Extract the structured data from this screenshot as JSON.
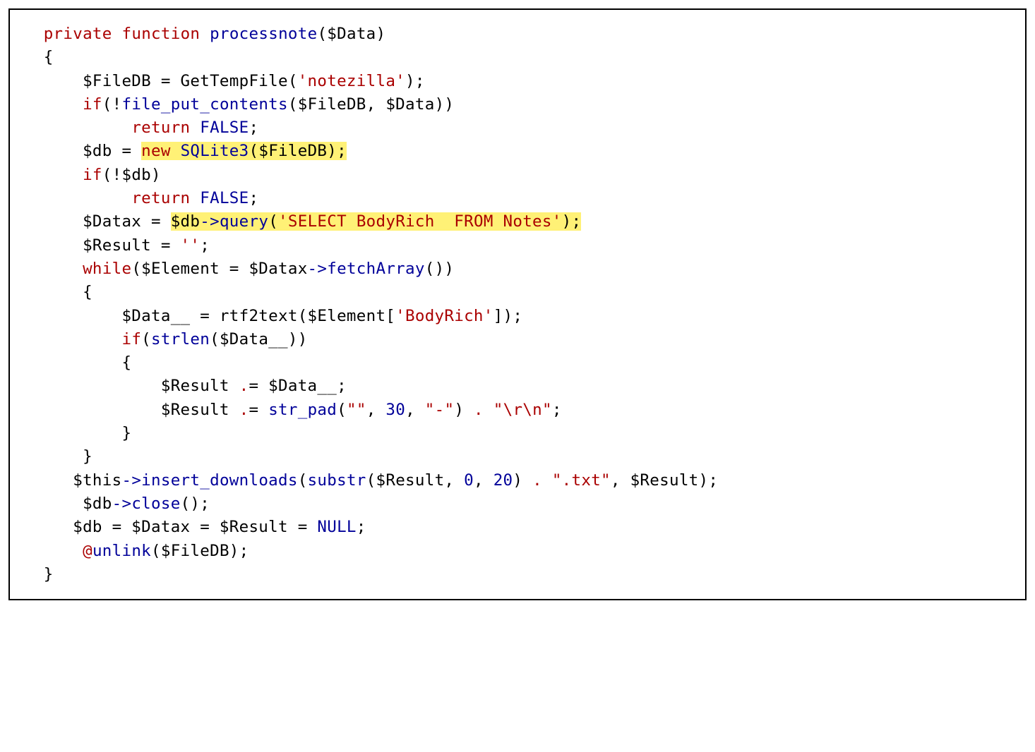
{
  "language": "php",
  "highlights": [
    {
      "line_index": 5,
      "text": "new SQLite3($FileDB);"
    },
    {
      "line_index": 8,
      "text": "$db->query('SELECT BodyRich  FROM Notes');"
    }
  ],
  "code_lines": [
    "  private function processnote($Data)",
    "  {",
    "      $FileDB = GetTempFile('notezilla');",
    "      if(!file_put_contents($FileDB, $Data))",
    "           return FALSE;",
    "      $db = new SQLite3($FileDB);",
    "      if(!$db)",
    "           return FALSE;",
    "      $Datax = $db->query('SELECT BodyRich  FROM Notes');",
    "      $Result = '';",
    "      while($Element = $Datax->fetchArray())",
    "      {",
    "          $Data__ = rtf2text($Element['BodyRich']);",
    "          if(strlen($Data__))",
    "          {",
    "              $Result .= $Data__;",
    "              $Result .= str_pad(\"\", 30, \"-\") . \"\\r\\n\";",
    "          }",
    "      }",
    "     $this->insert_downloads(substr($Result, 0, 20) . \".txt\", $Result);",
    "      $db->close();",
    "     $db = $Datax = $Result = NULL;",
    "      @unlink($FileDB);",
    "  }"
  ]
}
